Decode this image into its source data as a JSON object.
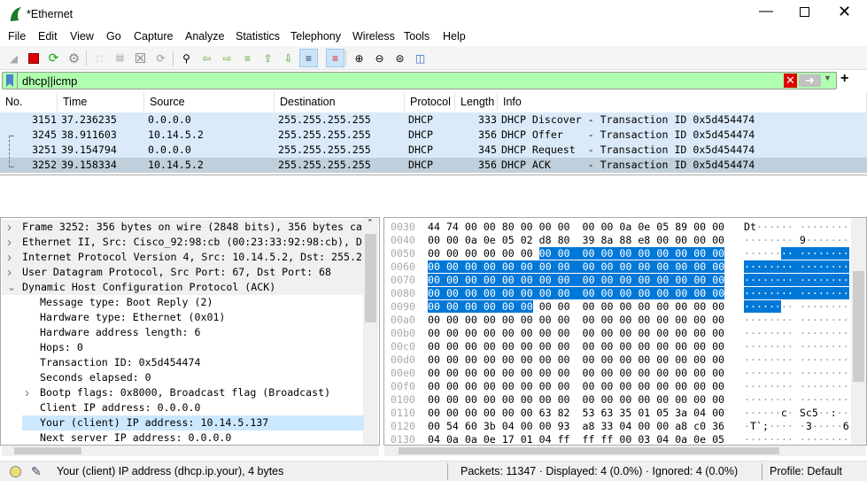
{
  "window": {
    "title": "*Ethernet"
  },
  "menu": [
    "File",
    "Edit",
    "View",
    "Go",
    "Capture",
    "Analyze",
    "Statistics",
    "Telephony",
    "Wireless",
    "Tools",
    "Help"
  ],
  "toolbar": [
    "shark-fin-start-icon",
    "stop-capture-icon",
    "restart-capture-icon",
    "capture-options-icon",
    "open-file-icon",
    "save-file-icon",
    "close-file-icon",
    "reload-file-icon",
    "find-packet-icon",
    "go-back-icon",
    "go-forward-icon",
    "go-to-packet-icon",
    "first-packet-icon",
    "last-packet-icon",
    "auto-scroll-icon",
    "colorize-icon",
    "zoom-in-icon",
    "zoom-out-icon",
    "normal-size-icon",
    "resize-columns-icon"
  ],
  "filter": {
    "value": "dhcp||icmp",
    "bg": "#afffaf"
  },
  "packet_list": {
    "columns": [
      "No.",
      "Time",
      "Source",
      "Destination",
      "Protocol",
      "Length",
      "Info"
    ],
    "rows": [
      [
        "3151",
        "37.236235",
        "0.0.0.0",
        "255.255.255.255",
        "DHCP",
        "333",
        "DHCP Discover - Transaction ID 0x5d454474"
      ],
      [
        "3245",
        "38.911603",
        "10.14.5.2",
        "255.255.255.255",
        "DHCP",
        "356",
        "DHCP Offer    - Transaction ID 0x5d454474"
      ],
      [
        "3251",
        "39.154794",
        "0.0.0.0",
        "255.255.255.255",
        "DHCP",
        "345",
        "DHCP Request  - Transaction ID 0x5d454474"
      ],
      [
        "3252",
        "39.158334",
        "10.14.5.2",
        "255.255.255.255",
        "DHCP",
        "356",
        "DHCP ACK      - Transaction ID 0x5d454474"
      ]
    ],
    "selected": "3252"
  },
  "details": [
    {
      "text": "Frame 3252: 356 bytes on wire (2848 bits), 356 bytes ca",
      "exp": "collapsed",
      "level": 0
    },
    {
      "text": "Ethernet II, Src: Cisco_92:98:cb (00:23:33:92:98:cb), D",
      "exp": "collapsed",
      "level": 0
    },
    {
      "text": "Internet Protocol Version 4, Src: 10.14.5.2, Dst: 255.2",
      "exp": "collapsed",
      "level": 0
    },
    {
      "text": "User Datagram Protocol, Src Port: 67, Dst Port: 68",
      "exp": "collapsed",
      "level": 0
    },
    {
      "text": "Dynamic Host Configuration Protocol (ACK)",
      "exp": "expanded",
      "level": 0
    },
    {
      "text": "Message type: Boot Reply (2)",
      "level": 1
    },
    {
      "text": "Hardware type: Ethernet (0x01)",
      "level": 1
    },
    {
      "text": "Hardware address length: 6",
      "level": 1
    },
    {
      "text": "Hops: 0",
      "level": 1
    },
    {
      "text": "Transaction ID: 0x5d454474",
      "level": 1
    },
    {
      "text": "Seconds elapsed: 0",
      "level": 1
    },
    {
      "text": "Bootp flags: 0x8000, Broadcast flag (Broadcast)",
      "exp": "collapsed",
      "level": 1
    },
    {
      "text": "Client IP address: 0.0.0.0",
      "level": 1
    },
    {
      "text": "Your (client) IP address: 10.14.5.137",
      "level": 1,
      "selected": true
    },
    {
      "text": "Next server IP address: 0.0.0.0",
      "level": 1
    }
  ],
  "hex": {
    "rows": [
      [
        "0030",
        "44 74 00 00 80 00 00 00 00 00 0a 0e 05 89 00 00"
      ],
      [
        "0040",
        "00 00 0a 0e 05 02 d8 80 39 8a 88 e8 00 00 00 00"
      ],
      [
        "0050",
        "00 00 00 00 00 00 00 00 00 00 00 00 00 00 00 00"
      ],
      [
        "0060",
        "00 00 00 00 00 00 00 00 00 00 00 00 00 00 00 00"
      ],
      [
        "0070",
        "00 00 00 00 00 00 00 00 00 00 00 00 00 00 00 00"
      ],
      [
        "0080",
        "00 00 00 00 00 00 00 00 00 00 00 00 00 00 00 00"
      ],
      [
        "0090",
        "00 00 00 00 00 00 00 00 00 00 00 00 00 00 00 00"
      ],
      [
        "00a0",
        "00 00 00 00 00 00 00 00 00 00 00 00 00 00 00 00"
      ],
      [
        "00b0",
        "00 00 00 00 00 00 00 00 00 00 00 00 00 00 00 00"
      ],
      [
        "00c0",
        "00 00 00 00 00 00 00 00 00 00 00 00 00 00 00 00"
      ],
      [
        "00d0",
        "00 00 00 00 00 00 00 00 00 00 00 00 00 00 00 00"
      ],
      [
        "00e0",
        "00 00 00 00 00 00 00 00 00 00 00 00 00 00 00 00"
      ],
      [
        "00f0",
        "00 00 00 00 00 00 00 00 00 00 00 00 00 00 00 00"
      ],
      [
        "0100",
        "00 00 00 00 00 00 00 00 00 00 00 00 00 00 00 00"
      ],
      [
        "0110",
        "00 00 00 00 00 00 63 82 53 63 35 01 05 3a 04 00"
      ],
      [
        "0120",
        "00 54 60 3b 04 00 00 93 a8 33 04 00 00 a8 c0 36"
      ],
      [
        "0130",
        "04 0a 0a 0e 17 01 04 ff ff ff 00 03 04 0a 0e 05"
      ]
    ],
    "selection_start": "0056",
    "selection_length": 64,
    "selection_color": "#0078d7"
  },
  "status": {
    "field": "Your (client) IP address (dhcp.ip.your), 4 bytes",
    "packets": "Packets: 11347 · Displayed: 4 (0.0%) · Ignored: 4 (0.0%)",
    "profile": "Profile: Default"
  }
}
